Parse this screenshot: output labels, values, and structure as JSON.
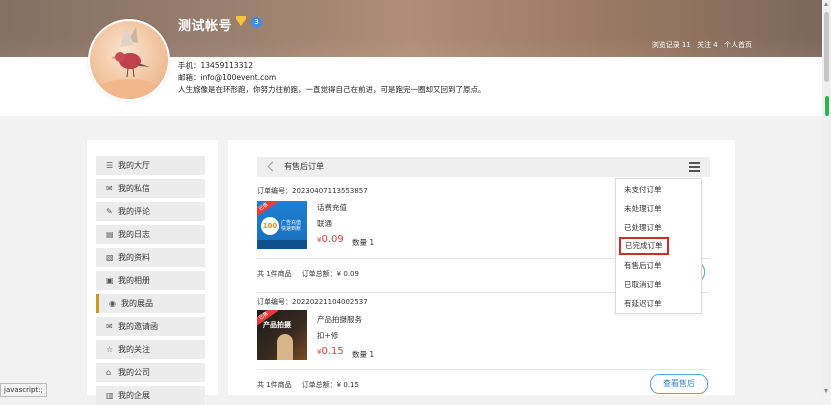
{
  "profile": {
    "username": "测试帐号",
    "level_badge": "3",
    "phone": "手机：13459113312",
    "email": "邮箱：info@100event.com",
    "motto": "人生旅像是在环形跑，你努力往前跑，一直觉得自己在前进，可是跑完一圈却又回到了原点。",
    "stats": {
      "views": "浏览记录 11",
      "following": "关注 4",
      "homepage": "个人首页"
    }
  },
  "sidebar": {
    "items": [
      {
        "icon": "☰",
        "label": "我的大厅"
      },
      {
        "icon": "✉",
        "label": "我的私信"
      },
      {
        "icon": "✎",
        "label": "我的评论"
      },
      {
        "icon": "▤",
        "label": "我的日志"
      },
      {
        "icon": "▧",
        "label": "我的资料"
      },
      {
        "icon": "▣",
        "label": "我的相册"
      },
      {
        "icon": "◉",
        "label": "我的展品"
      },
      {
        "icon": "✉",
        "label": "我的邀请函"
      },
      {
        "icon": "☆",
        "label": "我的关注"
      },
      {
        "icon": "⌂",
        "label": "我的公司"
      },
      {
        "icon": "▥",
        "label": "我的企展"
      }
    ],
    "active_index": 6
  },
  "main": {
    "title": "有售后订单",
    "orders": [
      {
        "order_no": "订单编号：20230407113553857",
        "product": "话费充值",
        "sub": "联通",
        "currency": "¥",
        "price": "0.09",
        "qty": "数量 1",
        "thumb_tag": "已售",
        "thumb_badge": "100",
        "thumb_text": "广告充值 快速到账",
        "total_items": "共 1件商品",
        "total_amount": "订单总额：¥ 0.09"
      },
      {
        "order_no": "订单编号：20220221104002537",
        "product": "产品拍摄服务",
        "sub": "扣+修",
        "currency": "¥",
        "price": "0.15",
        "qty": "数量 1",
        "thumb_tag": "已售",
        "thumb_text": "产品拍摄",
        "total_items": "共 1件商品",
        "total_amount": "订单总额：¥ 0.15",
        "button": "查看售后"
      }
    ]
  },
  "dropdown": {
    "items": [
      "未支付订单",
      "未处理订单",
      "已处理订单",
      "已完成订单",
      "有售后订单",
      "已取消订单",
      "有延迟订单"
    ],
    "highlighted_index": 3
  },
  "status_bar": "javascript:;",
  "colors": {
    "price": "#e4393c",
    "highlight_border": "#d42a2a",
    "button_border": "#5aa5d6",
    "active_marker": "#c49a2c"
  }
}
